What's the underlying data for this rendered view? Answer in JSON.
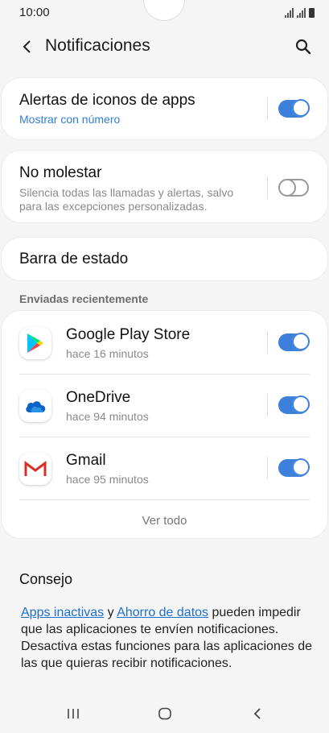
{
  "status_bar": {
    "time": "10:00"
  },
  "header": {
    "title": "Notificaciones",
    "back_icon": "chevron-left-icon",
    "search_icon": "search-icon"
  },
  "settings": {
    "app_icon_alerts": {
      "title": "Alertas de iconos de apps",
      "subtitle": "Mostrar con número",
      "enabled": true
    },
    "do_not_disturb": {
      "title": "No molestar",
      "subtitle_line1": "Silencia todas las llamadas y alertas, salvo",
      "subtitle_line2": "para las excepciones personalizadas.",
      "enabled": false
    },
    "status_bar": {
      "title": "Barra de estado"
    }
  },
  "recent": {
    "label": "Enviadas recientemente",
    "apps": [
      {
        "name": "Google Play Store",
        "time": "hace 16 minutos",
        "icon": "google-play-icon",
        "enabled": true
      },
      {
        "name": "OneDrive",
        "time": "hace 94 minutos",
        "icon": "onedrive-icon",
        "enabled": true
      },
      {
        "name": "Gmail",
        "time": "hace 95 minutos",
        "icon": "gmail-icon",
        "enabled": true
      }
    ],
    "see_all": "Ver todo"
  },
  "tip": {
    "title": "Consejo",
    "link1": "Apps inactivas",
    "connector": " y ",
    "link2": "Ahorro de datos",
    "text": " pueden impedir que las aplicaciones te envíen notificaciones. Desactiva estas funciones para las aplicaciones de las que quieras recibir notificaciones."
  },
  "colors": {
    "accent": "#3c80dc",
    "link": "#1f6fd0",
    "background": "#f5f5f5"
  }
}
